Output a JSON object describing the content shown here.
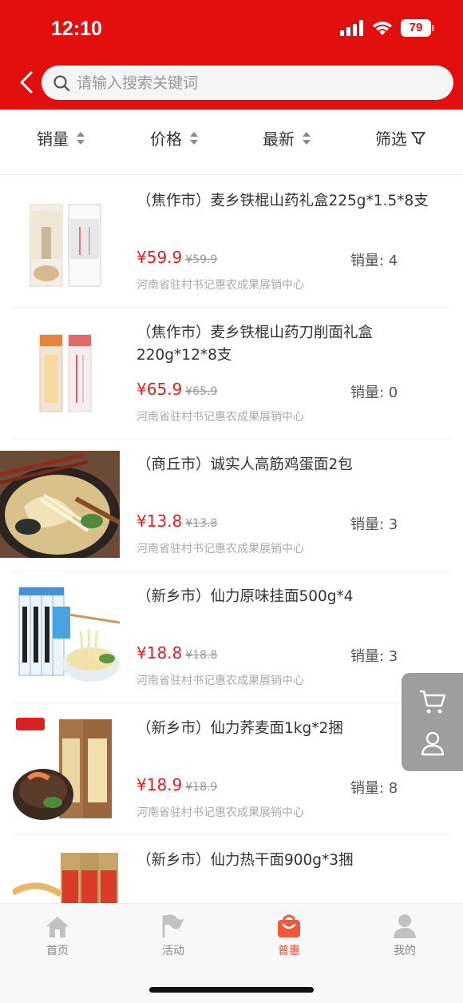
{
  "status": {
    "time": "12:10",
    "battery": "79"
  },
  "search": {
    "placeholder": "请输入搜索关键词"
  },
  "sort": {
    "sales": "销量",
    "price": "价格",
    "newest": "最新",
    "filter": "筛选"
  },
  "products": [
    {
      "title": "（焦作市）麦乡铁棍山药礼盒225g*1.5*8支",
      "price": "¥59.9",
      "orig": "¥59.9",
      "sales": "销量: 4",
      "store": "河南省驻村书记惠农成果展销中心"
    },
    {
      "title": "（焦作市）麦乡铁棍山药刀削面礼盒220g*12*8支",
      "price": "¥65.9",
      "orig": "¥65.9",
      "sales": "销量: 0",
      "store": "河南省驻村书记惠农成果展销中心"
    },
    {
      "title": "（商丘市）诚实人高筋鸡蛋面2包",
      "price": "¥13.8",
      "orig": "¥13.8",
      "sales": "销量: 3",
      "store": "河南省驻村书记惠农成果展销中心"
    },
    {
      "title": "（新乡市）仙力原味挂面500g*4",
      "price": "¥18.8",
      "orig": "¥18.8",
      "sales": "销量: 3",
      "store": "河南省驻村书记惠农成果展销中心"
    },
    {
      "title": "（新乡市）仙力荞麦面1kg*2捆",
      "price": "¥18.9",
      "orig": "¥18.9",
      "sales": "销量: 8",
      "store": "河南省驻村书记惠农成果展销中心"
    },
    {
      "title": "（新乡市）仙力热干面900g*3捆",
      "price": "",
      "orig": "",
      "sales": "",
      "store": ""
    }
  ],
  "tabs": {
    "home": "首页",
    "activity": "活动",
    "benefit": "普惠",
    "mine": "我的"
  },
  "colors": {
    "brand": "#e30e0e",
    "price": "#e02020",
    "active_tab": "#e8453c"
  }
}
